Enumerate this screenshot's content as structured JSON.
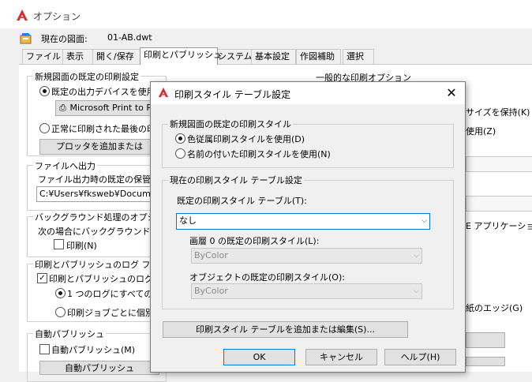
{
  "window": {
    "title": "オプション"
  },
  "drawing": {
    "label": "現在の図面:",
    "value": "01-AB.dwt"
  },
  "tabs": [
    "ファイル",
    "表示",
    "開く/保存",
    "印刷とパブリッシュ",
    "システム",
    "基本設定",
    "作図補助",
    "選択"
  ],
  "left": {
    "group1_title": "新規図面の既定の印刷設定",
    "radio1": "既定の出力デバイスを使用",
    "printer": "Microsoft Print to P",
    "radio2": "正常に印刷された最後の印",
    "btn_block": "プロッタを追加または",
    "group2_title": "ファイルへ出力",
    "file_label": "ファイル出力時の既定の保管場",
    "file_path": "C:¥Users¥fksweb¥Documen",
    "group3_title": "バックグラウンド処理のオプション",
    "bg_label": "次の場合にバックグラウンド処理",
    "bg_print": "印刷(N)",
    "group4_title": "印刷とパブリッシュのログ ファイル",
    "log_check": "印刷とパブリッシュのログ フ",
    "log_radio1": "1 つのログにすべての印",
    "log_radio2": "印刷ジョブごとに個別の",
    "group5_title": "自動パブリッシュ",
    "auto_check": "自動パブリッシュ(M)",
    "auto_btn": "自動パブリッシュ"
  },
  "right": {
    "group_title": "一般的な印刷オプション",
    "line1": "サイズを保持(K)",
    "line2": "使用(Z)",
    "line3": "E アプリケーションを",
    "line4": "紙のエッジ(G)"
  },
  "dialog": {
    "title": "印刷スタイル テーブル設定",
    "group1_title": "新規図面の既定の印刷スタイル",
    "radio_color": "色従属印刷スタイルを使用(D)",
    "radio_named": "名前の付いた印刷スタイルを使用(N)",
    "group2_title": "現在の印刷スタイル テーブル設定",
    "table_label": "既定の印刷スタイル テーブル(T):",
    "table_value": "なし",
    "layer0_label": "画層 0 の既定の印刷スタイル(L):",
    "layer0_value": "ByColor",
    "object_label": "オブジェクトの既定の印刷スタイル(O):",
    "object_value": "ByColor",
    "add_edit_btn": "印刷スタイル テーブルを追加または編集(S)...",
    "ok": "OK",
    "cancel": "キャンセル",
    "help": "ヘルプ(H)"
  },
  "colors": {
    "accent": "#0078d7",
    "autocad_red": "#d32f2f"
  }
}
